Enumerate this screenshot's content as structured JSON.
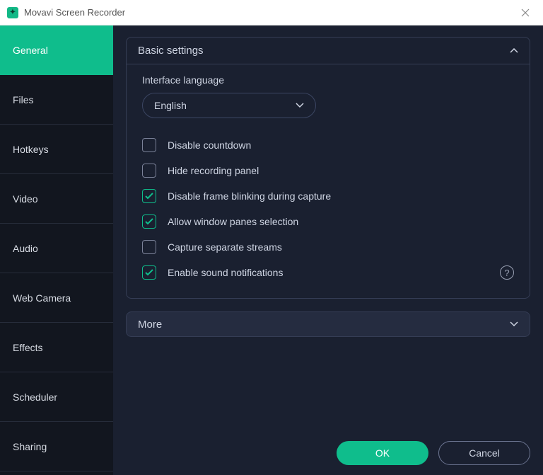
{
  "window": {
    "title": "Movavi Screen Recorder"
  },
  "sidebar": {
    "items": [
      {
        "label": "General",
        "active": true
      },
      {
        "label": "Files",
        "active": false
      },
      {
        "label": "Hotkeys",
        "active": false
      },
      {
        "label": "Video",
        "active": false
      },
      {
        "label": "Audio",
        "active": false
      },
      {
        "label": "Web Camera",
        "active": false
      },
      {
        "label": "Effects",
        "active": false
      },
      {
        "label": "Scheduler",
        "active": false
      },
      {
        "label": "Sharing",
        "active": false
      }
    ]
  },
  "panel": {
    "title": "Basic settings",
    "language_label": "Interface language",
    "language_value": "English",
    "checkboxes": [
      {
        "label": "Disable countdown",
        "checked": false
      },
      {
        "label": "Hide recording panel",
        "checked": false
      },
      {
        "label": "Disable frame blinking during capture",
        "checked": true
      },
      {
        "label": "Allow window panes selection",
        "checked": true
      },
      {
        "label": "Capture separate streams",
        "checked": false
      },
      {
        "label": "Enable sound notifications",
        "checked": true,
        "help": true
      }
    ]
  },
  "more": {
    "label": "More"
  },
  "footer": {
    "ok": "OK",
    "cancel": "Cancel"
  },
  "colors": {
    "accent": "#0fbd8c",
    "bg_dark": "#1a2030",
    "bg_darker": "#12161f"
  }
}
